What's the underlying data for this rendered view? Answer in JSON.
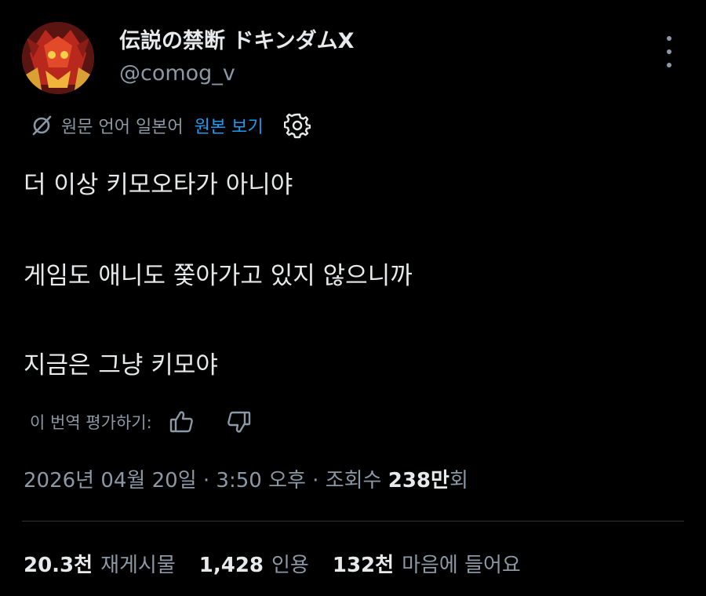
{
  "tweet": {
    "display_name": "伝説の禁断 ドキンダムX",
    "handle": "@comog_v",
    "translation": {
      "source_label": "원문 언어 일본어",
      "show_original": "원본 보기"
    },
    "text_lines": [
      "더 이상 키모오타가 아니야",
      "게임도 애니도 쫓아가고 있지 않으니까",
      "지금은 그냥 키모야"
    ],
    "rate_translation": "이 번역 평가하기:",
    "meta": {
      "date_time": "2026년 04월 20일 · 3:50 오후 · 조회수 ",
      "views": "238만",
      "views_suffix": "회"
    },
    "stats": {
      "reposts": {
        "count": "20.3천",
        "label": "재게시물"
      },
      "quotes": {
        "count": "1,428",
        "label": "인용"
      },
      "likes": {
        "count": "132천",
        "label": "마음에 들어요"
      }
    }
  },
  "colors": {
    "background": "#000000",
    "text": "#e7e9ea",
    "secondary": "#8b98a5",
    "link": "#1d9bf0",
    "divider": "#2f3336"
  },
  "icons": {
    "translate": "translate-slash-icon",
    "settings": "gear-icon",
    "more": "more-vertical-icon",
    "thumbs_up": "thumbs-up-icon",
    "thumbs_down": "thumbs-down-icon"
  }
}
